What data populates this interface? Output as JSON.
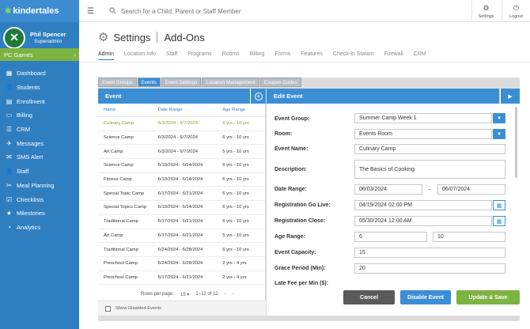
{
  "app": {
    "logo_text": "kindertales"
  },
  "user": {
    "name": "Phil Spencer",
    "role": "Superadmin"
  },
  "promo": {
    "label": "PC Games",
    "arrow": "›"
  },
  "sidebar": {
    "items": [
      {
        "icon": "dashboard-icon",
        "glyph": "▦",
        "label": "Dashboard"
      },
      {
        "icon": "students-icon",
        "glyph": "👤",
        "label": "Students"
      },
      {
        "icon": "enrollment-icon",
        "glyph": "▤",
        "label": "Enrollment"
      },
      {
        "icon": "billing-icon",
        "glyph": "▭",
        "label": "Billing"
      },
      {
        "icon": "crm-icon",
        "glyph": "☰",
        "label": "CRM"
      },
      {
        "icon": "messages-icon",
        "glyph": "✈",
        "label": "Messages"
      },
      {
        "icon": "sms-alert-icon",
        "glyph": "✉",
        "label": "SMS Alert"
      },
      {
        "icon": "staff-icon",
        "glyph": "👤",
        "label": "Staff"
      },
      {
        "icon": "meal-planning-icon",
        "glyph": "✂",
        "label": "Meal Planning"
      },
      {
        "icon": "checklists-icon",
        "glyph": "☑",
        "label": "Checklists"
      },
      {
        "icon": "milestones-icon",
        "glyph": "★",
        "label": "Milestones"
      },
      {
        "icon": "analytics-icon",
        "glyph": "◔",
        "label": "Analytics"
      }
    ]
  },
  "topbar": {
    "search_placeholder": "Search for a Child, Parent or Staff Member",
    "settings_label": "Settings",
    "logout_label": "Logout"
  },
  "page": {
    "title": "Settings",
    "subtitle": "Add-Ons",
    "tabs": [
      "Admin",
      "Location Info",
      "Staff",
      "Programs",
      "Rooms",
      "Billing",
      "Forms",
      "Features",
      "Check-In Station",
      "Firewall",
      "CRM"
    ],
    "active_tab": "Admin"
  },
  "panel_tabs": {
    "items": [
      "Event Groups",
      "Events",
      "Event Settings",
      "Location Management",
      "Coupon Codes"
    ],
    "active": "Events"
  },
  "event_list": {
    "header": "Event",
    "columns": [
      "Name",
      "Date Range",
      "Age Range"
    ],
    "rows": [
      {
        "name": "Culinary Camp",
        "dates": "6/3/2024 - 6/7/2024",
        "ages": "6 yrs - 10 yrs",
        "selected": true
      },
      {
        "name": "Science Camp",
        "dates": "6/3/2024 - 6/7/2024",
        "ages": "6 yrs - 10 yrs"
      },
      {
        "name": "Art Camp",
        "dates": "6/3/2024 - 6/7/2024",
        "ages": "5 yrs - 10 yrs"
      },
      {
        "name": "Science Camp",
        "dates": "6/10/2024 - 6/14/2024",
        "ages": "6 yrs - 10 yrs"
      },
      {
        "name": "Fitness Camp",
        "dates": "6/10/2024 - 6/14/2024",
        "ages": "6 yrs - 10 yrs"
      },
      {
        "name": "Special Topic Camp",
        "dates": "6/17/2024 - 6/21/2024",
        "ages": "6 yrs - 10 yrs"
      },
      {
        "name": "Special Topics Camp",
        "dates": "6/10/2024 - 6/14/2024",
        "ages": "6 yrs - 10 yrs"
      },
      {
        "name": "Traditional Camp",
        "dates": "6/17/2024 - 6/21/2024",
        "ages": "6 yrs - 10 yrs"
      },
      {
        "name": "Art Camp",
        "dates": "6/17/2024 - 6/21/2024",
        "ages": "5 yrs - 10 yrs"
      },
      {
        "name": "Traditional Camp",
        "dates": "6/24/2024 - 6/28/2024",
        "ages": "6 yrs - 10 yrs"
      },
      {
        "name": "Preschool Camp",
        "dates": "6/24/2024 - 6/28/2024",
        "ages": "2 yrs - 4 yrs"
      },
      {
        "name": "Preschool Camp",
        "dates": "6/17/2024 - 6/21/2024",
        "ages": "2 yrs - 4 yrs"
      }
    ],
    "rows_per_page_label": "Rows per page:",
    "rows_per_page_value": "15",
    "range_text": "1–12 of 12",
    "show_disabled_label": "Show Disabled Events"
  },
  "edit_event": {
    "header": "Edit Event",
    "event_group_label": "Event Group:",
    "event_group_value": "Summer Camp Week 1",
    "room_label": "Room:",
    "room_value": "Events Room",
    "event_name_label": "Event Name:",
    "event_name_value": "Culinary Camp",
    "description_label": "Description:",
    "description_value": "The Basics of Cooking",
    "date_range_label": "Date Range:",
    "date_start": "06/03/2024",
    "date_sep": "–",
    "date_end": "06/07/2024",
    "reg_live_label": "Registration Go Live:",
    "reg_live_value": "04/19/2024 02:00 PM",
    "reg_close_label": "Registration Close:",
    "reg_close_value": "05/30/2024 12:00 AM",
    "age_range_label": "Age Range:",
    "age_min": "6",
    "age_max": "10",
    "capacity_label": "Event Capacity:",
    "capacity_value": "15",
    "grace_label": "Grace Period (Min):",
    "grace_value": "20",
    "late_fee_label": "Late Fee per Min ($):",
    "cancel_label": "Cancel",
    "disable_label": "Disable Event",
    "save_label": "Update & Save"
  },
  "colors": {
    "sidebar": "#2f7ec0",
    "accent": "#3b8ed4",
    "green": "#7cb342",
    "cancel": "#5a5a5a"
  }
}
